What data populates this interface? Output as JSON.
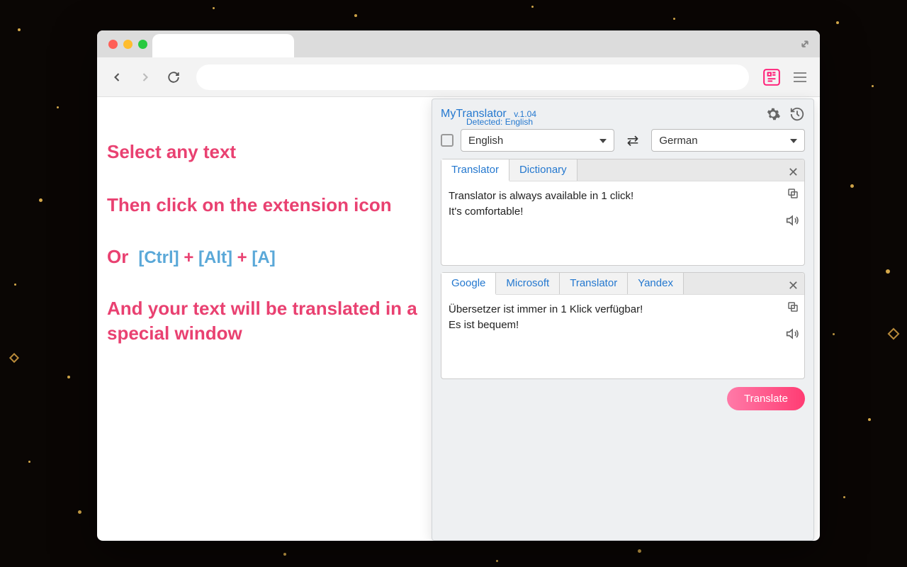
{
  "instructions": {
    "line1": "Select any text",
    "line2": "Then click on the extension icon",
    "or": "Or",
    "key_ctrl": "[Ctrl]",
    "key_plus1": " + ",
    "key_alt": "[Alt]",
    "key_plus2": " + ",
    "key_a": "[A]",
    "line3": "And your text will be translated in a special window"
  },
  "popup": {
    "title": "MyTranslator",
    "version": "v.1.04",
    "detected": "Detected: English",
    "source_lang": "English",
    "target_lang": "German",
    "input_tabs": [
      "Translator",
      "Dictionary"
    ],
    "input_text": "Translator is always available in 1 click!\nIt's comfortable!",
    "output_tabs": [
      "Google",
      "Microsoft",
      "Translator",
      "Yandex"
    ],
    "output_text": "Übersetzer ist immer in 1 Klick verfügbar!\nEs ist bequem!",
    "translate_label": "Translate"
  }
}
